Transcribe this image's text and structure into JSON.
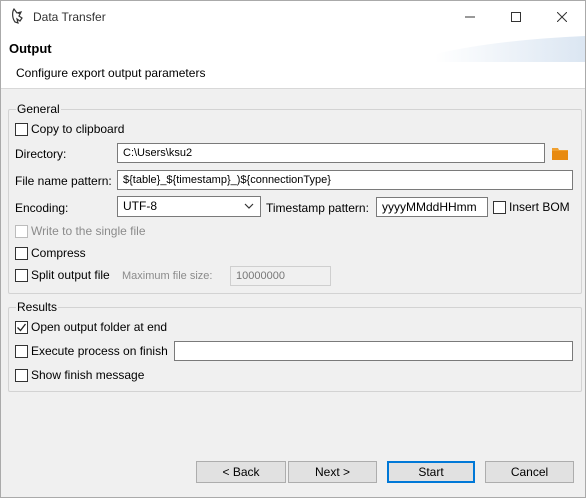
{
  "window": {
    "title": "Data Transfer"
  },
  "header": {
    "title": "Output",
    "description": "Configure export output parameters"
  },
  "general": {
    "label": "General",
    "copy_to_clipboard": {
      "label": "Copy to clipboard",
      "checked": false
    },
    "directory": {
      "label": "Directory:",
      "value": "C:\\Users\\ksu2"
    },
    "file_name_pattern": {
      "label": "File name pattern:",
      "value": "${table}_${timestamp}_)${connectionType}"
    },
    "encoding": {
      "label": "Encoding:",
      "value": "UTF-8"
    },
    "timestamp_pattern": {
      "label": "Timestamp pattern:",
      "value": "yyyyMMddHHmm"
    },
    "insert_bom": {
      "label": "Insert BOM",
      "checked": false
    },
    "write_single_file": {
      "label": "Write to the single file",
      "checked": false,
      "enabled": false
    },
    "compress": {
      "label": "Compress",
      "checked": false
    },
    "split_output_file": {
      "label": "Split output file",
      "checked": false
    },
    "max_file_size": {
      "label": "Maximum file size:",
      "value": "10000000"
    }
  },
  "results": {
    "label": "Results",
    "open_output_folder": {
      "label": "Open output folder at end",
      "checked": true
    },
    "execute_process": {
      "label": "Execute process on finish",
      "checked": false,
      "value": ""
    },
    "show_finish_message": {
      "label": "Show finish message",
      "checked": false
    }
  },
  "buttons": {
    "back": "< Back",
    "next": "Next >",
    "start": "Start",
    "cancel": "Cancel"
  },
  "colors": {
    "accent": "#0078d7",
    "folder": "#f0a030"
  }
}
